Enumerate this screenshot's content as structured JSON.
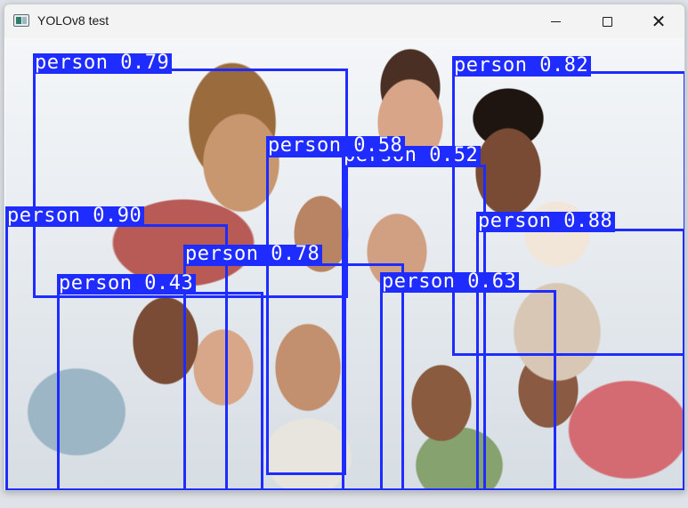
{
  "window": {
    "title": "YOLOv8 test",
    "controls": {
      "minimize": "minimize-icon",
      "maximize": "maximize-icon",
      "close": "close-icon",
      "close_glyph": "✕"
    }
  },
  "detections": [
    {
      "label": "person 0.79"
    },
    {
      "label": "person 0.82"
    },
    {
      "label": "person 0.58"
    },
    {
      "label": "person 0.52"
    },
    {
      "label": "person 0.90"
    },
    {
      "label": "person 0.88"
    },
    {
      "label": "person 0.78"
    },
    {
      "label": "person 0.43"
    },
    {
      "label": "person 0.63"
    }
  ],
  "colors": {
    "box": "#1e2cff",
    "label_text": "#ffffff",
    "titlebar": "#f3f3f3"
  }
}
